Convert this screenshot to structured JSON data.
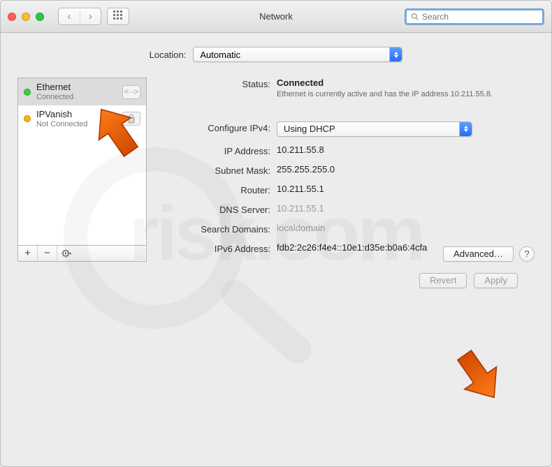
{
  "window": {
    "title": "Network",
    "search_placeholder": "Search"
  },
  "location": {
    "label": "Location:",
    "value": "Automatic"
  },
  "sidebar": {
    "items": [
      {
        "name": "Ethernet",
        "status": "Connected",
        "dot": "green",
        "icon": "ethernet-icon"
      },
      {
        "name": "IPVanish",
        "status": "Not Connected",
        "dot": "orange",
        "icon": "vpn-lock-icon"
      }
    ],
    "controls": {
      "add": "+",
      "remove": "−",
      "gear": "✿▾"
    }
  },
  "details": {
    "status_label": "Status:",
    "status_value": "Connected",
    "status_desc": "Ethernet is currently active and has the IP address 10.211.55.8.",
    "configure_label": "Configure IPv4:",
    "configure_value": "Using DHCP",
    "ip_label": "IP Address:",
    "ip_value": "10.211.55.8",
    "mask_label": "Subnet Mask:",
    "mask_value": "255.255.255.0",
    "router_label": "Router:",
    "router_value": "10.211.55.1",
    "dns_label": "DNS Server:",
    "dns_value": "10.211.55.1",
    "search_label": "Search Domains:",
    "search_value": "localdomain",
    "ipv6_label": "IPv6 Address:",
    "ipv6_value": "fdb2:2c26:f4e4::10e1:d35e:b0a6:4cfa",
    "advanced": "Advanced…",
    "help": "?"
  },
  "buttons": {
    "revert": "Revert",
    "apply": "Apply"
  },
  "colors": {
    "accent": "#2a6cf6",
    "green": "#37d53a",
    "orange": "#ffb400"
  }
}
